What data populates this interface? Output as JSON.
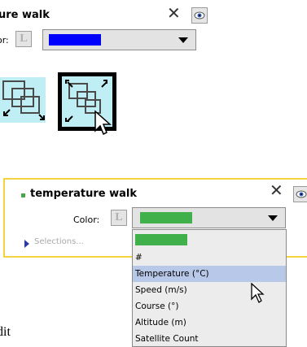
{
  "top_panel": {
    "title": "ure walk",
    "color_label": "or:",
    "l_button": "L",
    "swatch_color": "#0000ff"
  },
  "icons": [
    "shrink-windows-icon",
    "expand-windows-icon"
  ],
  "lower_panel": {
    "title": "temperature walk",
    "color_label": "Color:",
    "l_button": "L",
    "swatch_color": "#3fb04a",
    "selections_label": "Selections...",
    "accent_color": "#f5d242"
  },
  "dropdown": {
    "swatch_color": "#3fb04a",
    "items": [
      "#",
      "Temperature (°C)",
      "Speed (m/s)",
      "Course (°)",
      "Altitude (m)",
      "Satellite Count"
    ],
    "selected_index": 1
  },
  "edit_fragment": "dit"
}
